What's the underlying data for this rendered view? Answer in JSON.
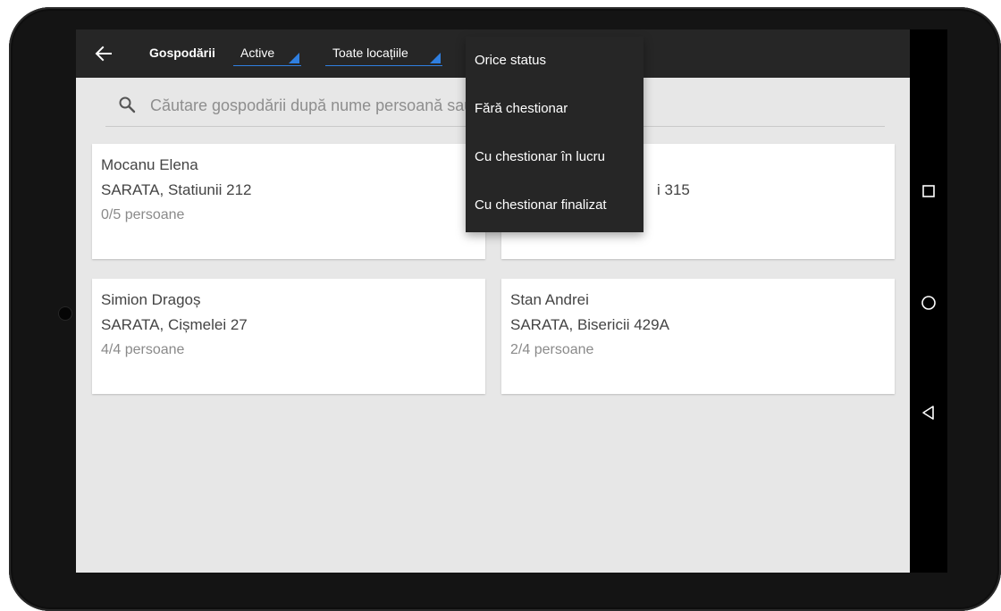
{
  "appbar": {
    "title": "Gospodării",
    "status_filter": "Active",
    "location_filter": "Toate locațiile"
  },
  "search": {
    "placeholder": "Căutare gospodării după nume persoană sau adresă"
  },
  "status_menu": {
    "items": [
      {
        "label": "Orice status"
      },
      {
        "label": "Fără chestionar"
      },
      {
        "label": "Cu chestionar în lucru"
      },
      {
        "label": "Cu chestionar finalizat"
      }
    ]
  },
  "households": [
    {
      "name": "Mocanu Elena",
      "address": "SARATA, Statiunii 212",
      "persons": "0/5 persoane"
    },
    {
      "name": "",
      "address": "i 315",
      "persons": ""
    },
    {
      "name": "Simion Dragoș",
      "address": "SARATA, Cișmelei 27",
      "persons": "4/4 persoane"
    },
    {
      "name": "Stan Andrei",
      "address": "SARATA, Bisericii 429A",
      "persons": "2/4 persoane"
    }
  ],
  "colors": {
    "accent": "#2f7fe0",
    "appbar": "#262626",
    "background": "#e7e7e7",
    "card": "#ffffff"
  },
  "icons": {
    "back": "arrow-back-icon",
    "search": "search-icon",
    "recents": "square-icon",
    "home": "circle-icon",
    "back_nav": "triangle-back-icon"
  }
}
